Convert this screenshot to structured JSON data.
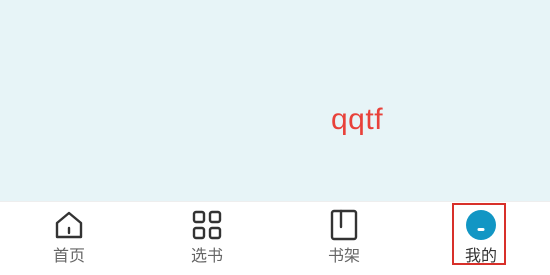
{
  "profile": {
    "username": "qqtf"
  },
  "tabbar": {
    "tabs": [
      {
        "label": "首页",
        "icon": "home-icon"
      },
      {
        "label": "选书",
        "icon": "grid-icon"
      },
      {
        "label": "书架",
        "icon": "bookshelf-icon"
      },
      {
        "label": "我的",
        "icon": "profile-icon"
      }
    ],
    "active_index": 3
  },
  "colors": {
    "content_bg": "#e7f4f7",
    "username_text": "#e8413a",
    "active_icon": "#1296c4",
    "highlight_border": "#d8302a"
  }
}
